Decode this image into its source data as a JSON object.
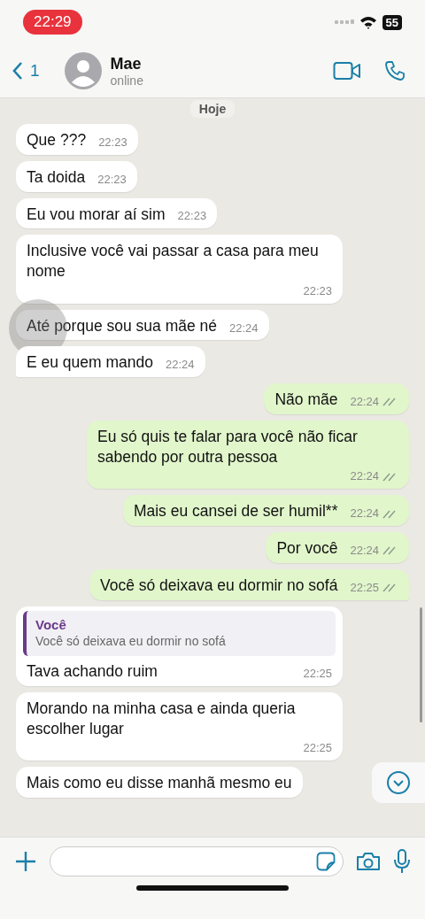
{
  "status_bar": {
    "time": "22:29",
    "battery": "55"
  },
  "header": {
    "back_count": "1",
    "name": "Mae",
    "status": "online"
  },
  "date_chip": "Hoje",
  "messages": [
    {
      "kind": "in",
      "text": "Que ???",
      "time": "22:23"
    },
    {
      "kind": "in",
      "text": "Ta doida",
      "time": "22:23"
    },
    {
      "kind": "in",
      "text": "Eu vou morar aí sim",
      "time": "22:23"
    },
    {
      "kind": "in",
      "text": "Inclusive você vai passar a casa para meu nome",
      "time": "22:23"
    },
    {
      "kind": "in",
      "text": "Até porque sou sua mãe né",
      "time": "22:24",
      "touched": true
    },
    {
      "kind": "in",
      "text": "E eu quem mando",
      "time": "22:24",
      "tail": true
    },
    {
      "kind": "out",
      "text": "Não mãe",
      "time": "22:24"
    },
    {
      "kind": "out",
      "text": "Eu só quis te falar para você não ficar sabendo por outra pessoa",
      "time": "22:24"
    },
    {
      "kind": "out",
      "text": "Mais eu cansei de ser humil**",
      "time": "22:24"
    },
    {
      "kind": "out",
      "text": "Por você",
      "time": "22:24"
    },
    {
      "kind": "out",
      "text": "Você só deixava eu dormir no sofá",
      "time": "22:25",
      "tail": true
    },
    {
      "kind": "in",
      "quote": {
        "author": "Você",
        "text": "Você só deixava eu dormir no sofá"
      },
      "text": "Tava achando ruim",
      "time": "22:25"
    },
    {
      "kind": "in",
      "text": "Morando na minha casa e ainda queria escolher lugar",
      "time": "22:25"
    },
    {
      "kind": "in",
      "text": "Mais como eu disse manhã mesmo eu"
    }
  ]
}
